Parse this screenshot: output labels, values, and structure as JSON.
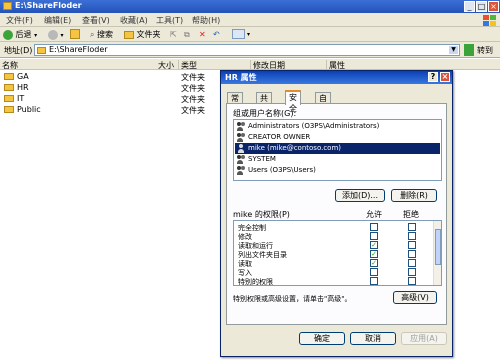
{
  "window": {
    "title": "E:\\ShareFloder"
  },
  "menu": [
    "文件(F)",
    "编辑(E)",
    "查看(V)",
    "收藏(A)",
    "工具(T)",
    "帮助(H)"
  ],
  "toolbar": {
    "back": "后退",
    "search": "搜索",
    "folders": "文件夹"
  },
  "address": {
    "label": "地址(D)",
    "value": "E:\\ShareFloder",
    "go": "转到"
  },
  "columns": [
    "名称",
    "大小",
    "类型",
    "修改日期",
    "属性"
  ],
  "files": [
    {
      "name": "GA",
      "type": "文件夹"
    },
    {
      "name": "HR",
      "type": "文件夹"
    },
    {
      "name": "IT",
      "type": "文件夹"
    },
    {
      "name": "Public",
      "type": "文件夹"
    }
  ],
  "dialog": {
    "title": "HR 属性",
    "tabs": [
      "常规",
      "共享",
      "安全",
      "自定义"
    ],
    "active_tab": "安全",
    "groups_label": "组或用户名称(G):",
    "users": [
      "Administrators (O3PS\\Administrators)",
      "CREATOR OWNER",
      "mike (mike@contoso.com)",
      "SYSTEM",
      "Users (O3PS\\Users)"
    ],
    "selected_user": 2,
    "add_button": "添加(D)...",
    "remove_button": "删除(R)",
    "perm_label": "mike 的权限(P)",
    "allow_label": "允许",
    "deny_label": "拒绝",
    "permissions": [
      {
        "name": "完全控制",
        "allow": false,
        "deny": false
      },
      {
        "name": "修改",
        "allow": false,
        "deny": false
      },
      {
        "name": "读取和运行",
        "allow": true,
        "deny": false
      },
      {
        "name": "列出文件夹目录",
        "allow": true,
        "deny": false
      },
      {
        "name": "读取",
        "allow": true,
        "deny": false
      },
      {
        "name": "写入",
        "allow": false,
        "deny": false
      },
      {
        "name": "特别的权限",
        "allow": false,
        "deny": false
      }
    ],
    "advanced_text": "特别权限或高级设置，请单击\"高级\"。",
    "advanced_button": "高级(V)",
    "ok_button": "确定",
    "cancel_button": "取消",
    "apply_button": "应用(A)"
  }
}
